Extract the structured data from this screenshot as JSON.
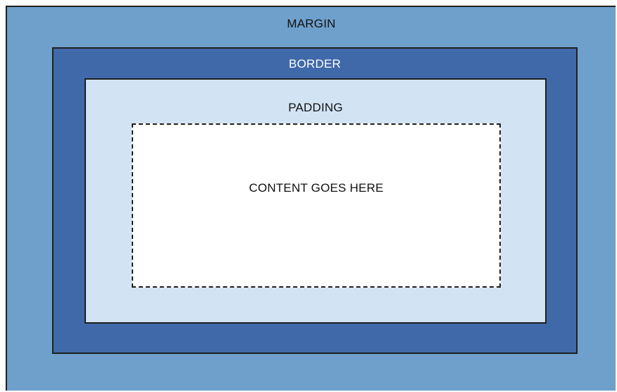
{
  "diagram": {
    "margin_label": "MARGIN",
    "border_label": "BORDER",
    "padding_label": "PADDING",
    "content_label": "CONTENT GOES HERE"
  },
  "colors": {
    "margin": "#6fa0cb",
    "border": "#4069a9",
    "padding": "#d2e4f4",
    "content": "#ffffff",
    "outline": "#1f1f1f"
  }
}
